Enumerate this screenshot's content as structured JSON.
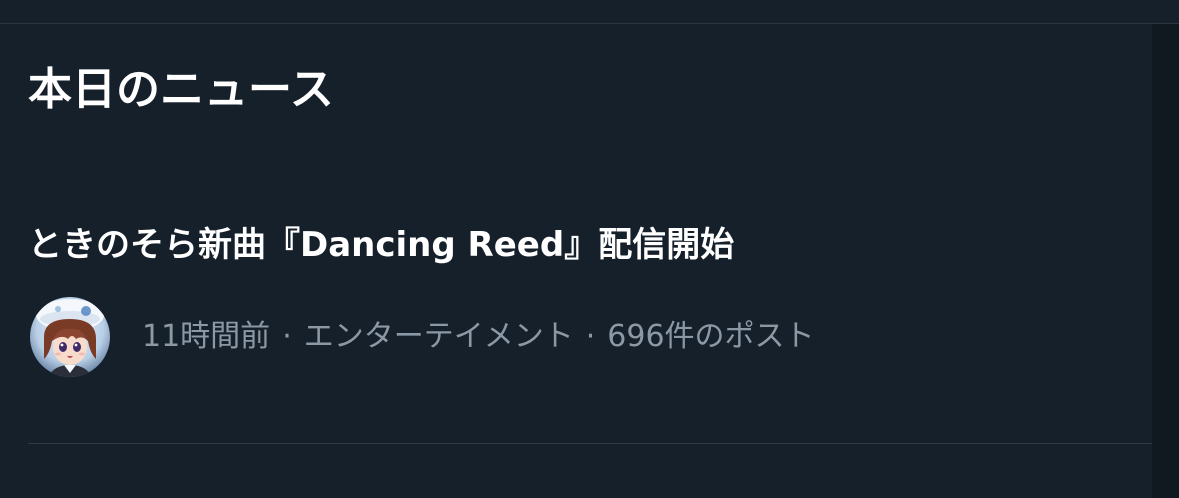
{
  "section": {
    "title": "本日のニュース"
  },
  "news": {
    "headline": "ときのそら新曲『Dancing Reed』配信開始",
    "time": "11時間前",
    "separator": "·",
    "category": "エンターテイメント",
    "post_count": "696件のポスト",
    "avatar_icon": "character-avatar-icon"
  },
  "colors": {
    "background": "#16202b",
    "title_text": "#ffffff",
    "meta_text": "#8b98a5",
    "divider": "#2f3a45"
  }
}
